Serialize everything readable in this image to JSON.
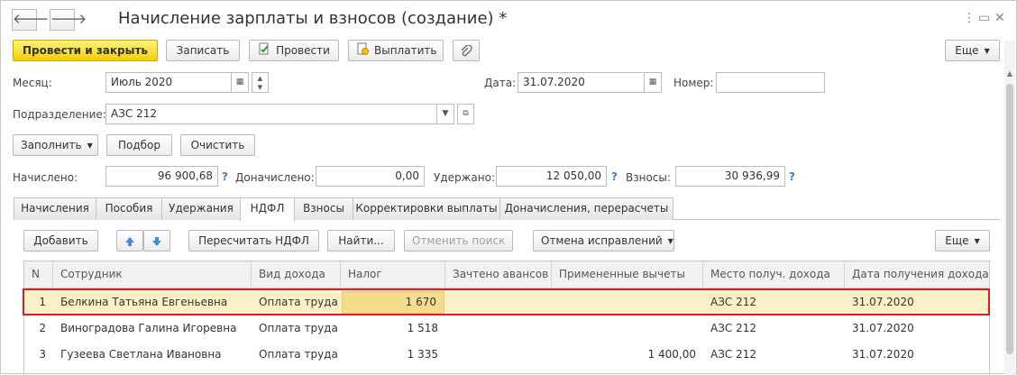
{
  "window": {
    "title": "Начисление зарплаты и взносов (создание) *",
    "back_glyph": "🡐",
    "forward_glyph": "🡒",
    "more_glyph": "⋮",
    "restore_glyph": "▭",
    "close_glyph": "✕"
  },
  "toolbar": {
    "post_close": "Провести и закрыть",
    "save": "Записать",
    "post": "Провести",
    "pay": "Выплатить",
    "more": "Еще"
  },
  "form": {
    "month_label": "Месяц:",
    "month_value": "Июль 2020",
    "date_label": "Дата:",
    "date_value": "31.07.2020",
    "number_label": "Номер:",
    "number_value": "",
    "division_label": "Подразделение:",
    "division_value": "АЗС 212"
  },
  "actions": {
    "fill": "Заполнить",
    "select": "Подбор",
    "clear": "Очистить"
  },
  "totals": {
    "accrued_label": "Начислено:",
    "accrued_value": "96 900,68",
    "extra_label": "Доначислено:",
    "extra_value": "0,00",
    "withheld_label": "Удержано:",
    "withheld_value": "12 050,00",
    "contrib_label": "Взносы:",
    "contrib_value": "30 936,99",
    "help": "?"
  },
  "tabs": [
    {
      "label": "Начисления"
    },
    {
      "label": "Пособия"
    },
    {
      "label": "Удержания"
    },
    {
      "label": "НДФЛ"
    },
    {
      "label": "Взносы"
    },
    {
      "label": "Корректировки выплаты"
    },
    {
      "label": "Доначисления, перерасчеты"
    }
  ],
  "tab_toolbar": {
    "add": "Добавить",
    "recalc": "Пересчитать НДФЛ",
    "find": "Найти...",
    "cancel_search": "Отменить поиск",
    "cancel_fix": "Отмена исправлений",
    "more": "Еще"
  },
  "table": {
    "columns": [
      "N",
      "Сотрудник",
      "Вид дохода",
      "Налог",
      "Зачтено авансов",
      "Примененные вычеты",
      "Место получ. дохода",
      "Дата получения дохода"
    ],
    "rows": [
      {
        "n": "1",
        "employee": "Белкина Татьяна Евгеньевна",
        "income_type": "Оплата труда",
        "tax": "1 670",
        "advances": "",
        "deductions": "",
        "place": "АЗС 212",
        "date": "31.07.2020"
      },
      {
        "n": "2",
        "employee": "Виноградова Галина Игоревна",
        "income_type": "Оплата труда",
        "tax": "1 518",
        "advances": "",
        "deductions": "",
        "place": "АЗС 212",
        "date": "31.07.2020"
      },
      {
        "n": "3",
        "employee": "Гузеева Светлана Ивановна",
        "income_type": "Оплата труда",
        "tax": "1 335",
        "advances": "",
        "deductions": "1 400,00",
        "place": "АЗС 212",
        "date": "31.07.2020"
      }
    ]
  },
  "colors": {
    "primary_button": "#f1d00a",
    "selected_row": "#fbf1c6",
    "selection_frame": "#d1202a",
    "help_link": "#3d7ec8"
  }
}
